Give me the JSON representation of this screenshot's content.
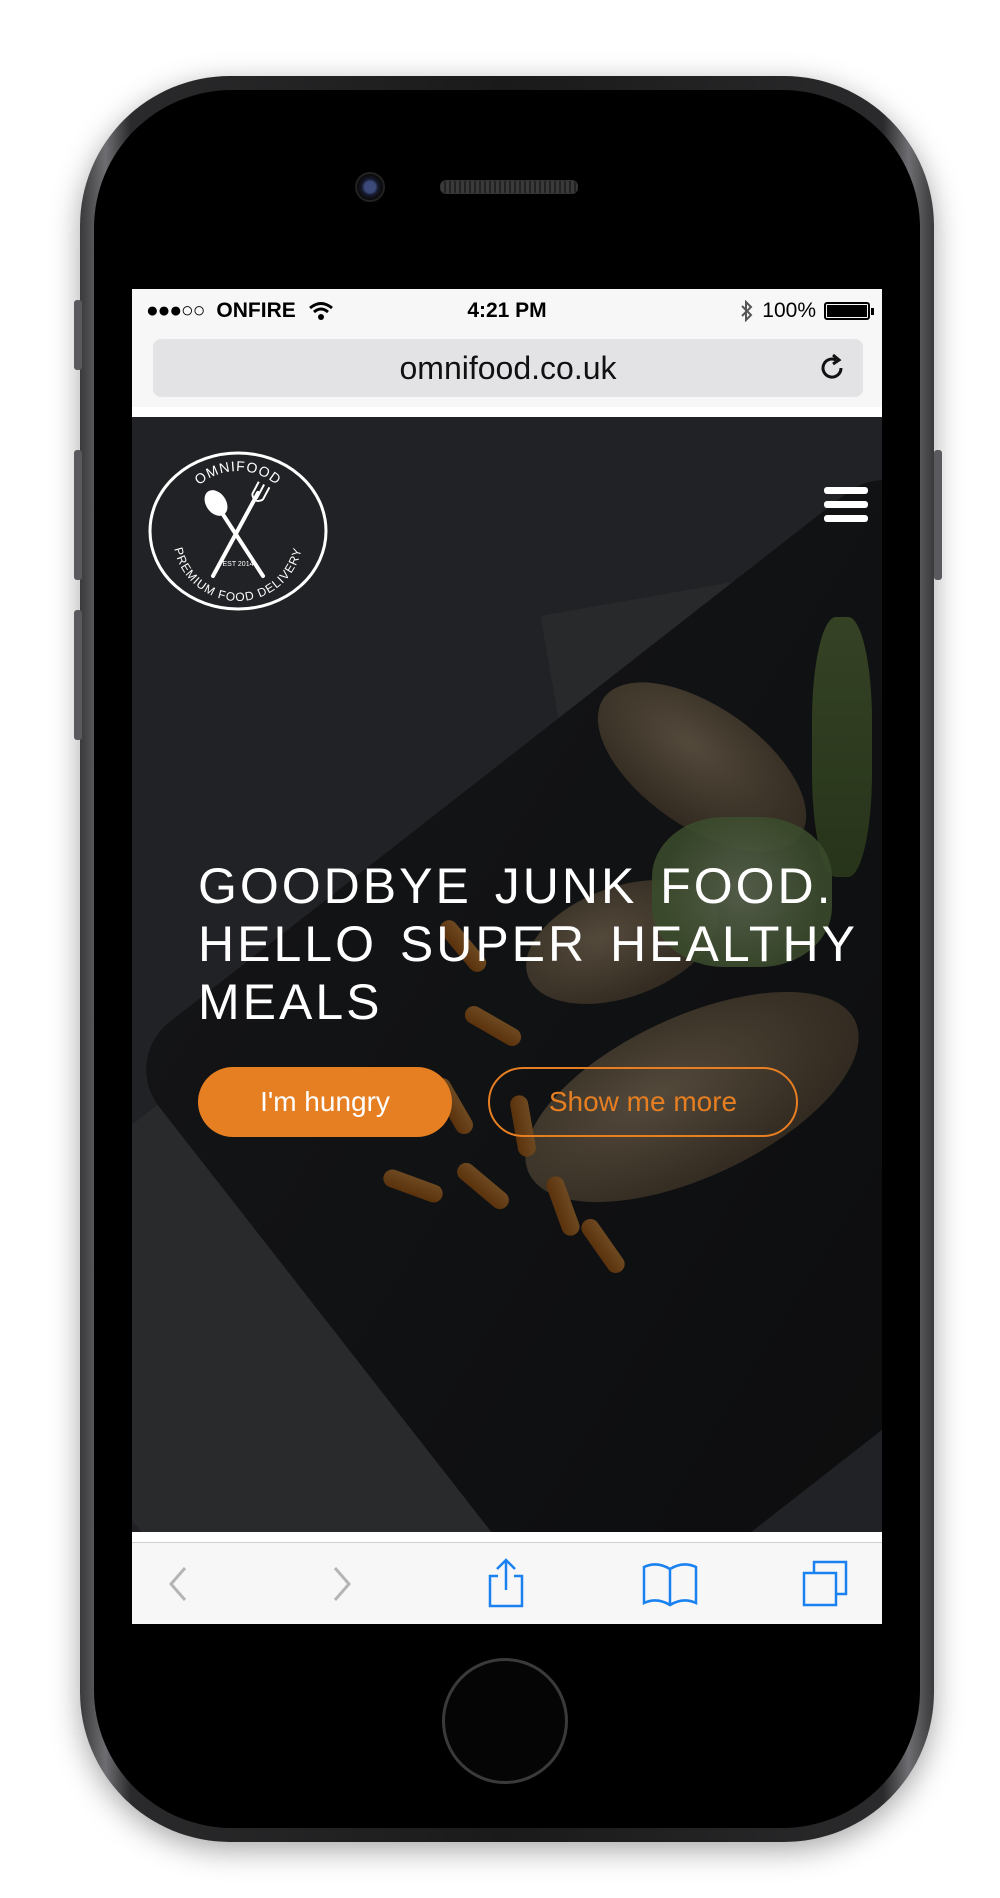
{
  "statusbar": {
    "carrier": "ONFIRE",
    "signal_dots": "●●●○○",
    "time": "4:21 PM",
    "battery": "100%",
    "battery_level": 1.0
  },
  "browser": {
    "url": "omnifood.co.uk",
    "icons": {
      "reload": "reload-icon",
      "back": "back-chevron-icon",
      "forward": "forward-chevron-icon",
      "share": "share-icon",
      "bookmarks": "bookmarks-icon",
      "tabs": "tabs-icon"
    }
  },
  "site": {
    "logo": {
      "top_text": "OMNIFOOD",
      "est_text": "EST 2014",
      "bottom_text": "PREMIUM FOOD DELIVERY"
    },
    "headline": [
      "GOODBYE JUNK FOOD.",
      "HELLO SUPER HEALTHY",
      "MEALS"
    ],
    "primary_button": "I'm hungry",
    "secondary_button": "Show me more",
    "accent_color": "#e67e22"
  }
}
